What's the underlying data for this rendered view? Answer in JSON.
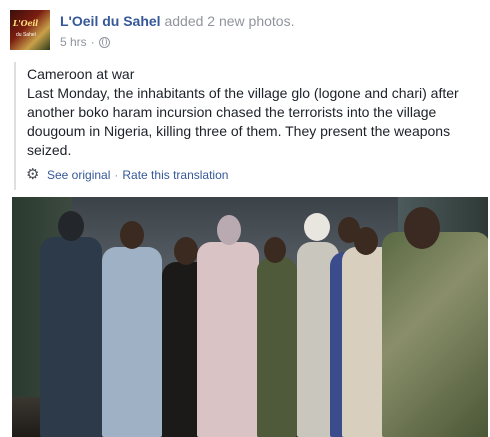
{
  "header": {
    "page_name": "L'Oeil du Sahel",
    "action": "added 2 new photos.",
    "timestamp": "5 hrs",
    "separator": "·",
    "privacy_icon": "globe-icon"
  },
  "avatar": {
    "logo_text": "L'Oeil",
    "logo_subtext": "du Sahel"
  },
  "post": {
    "line1": "Cameroon at war",
    "body": "Last Monday, the inhabitants of the village glo (logone and chari) after another boko haram incursion chased the terrorists into the village dougoum in Nigeria, killing three of them. They present the weapons seized."
  },
  "translation": {
    "icon": "gear-icon",
    "see_original": "See original",
    "separator": "·",
    "rate": "Rate this translation"
  },
  "colors": {
    "link": "#365899",
    "muted": "#90949c",
    "text": "#1d2129"
  }
}
